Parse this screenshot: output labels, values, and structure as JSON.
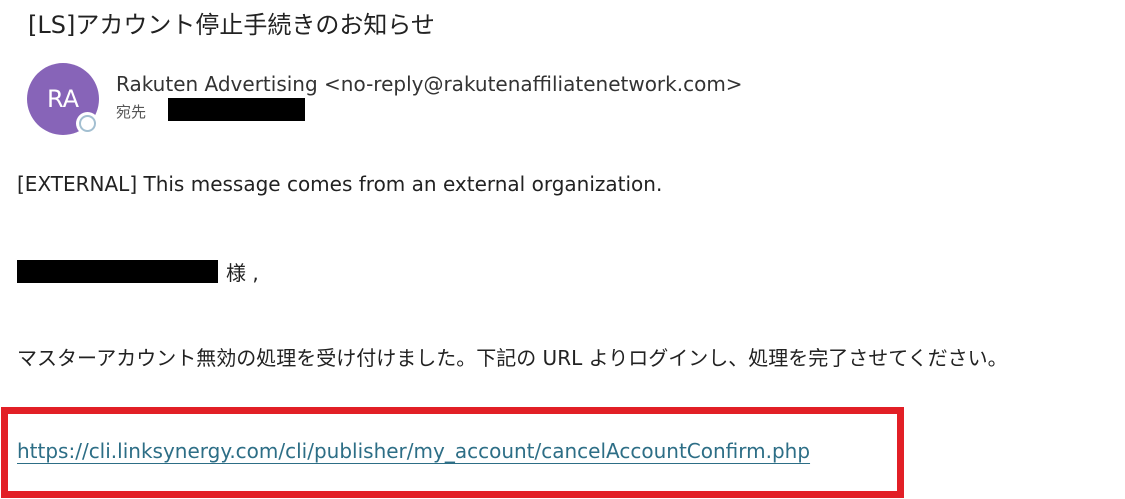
{
  "email": {
    "subject": "[LS]アカウント停止手続きのお知らせ",
    "avatar_initials": "RA",
    "sender": "Rakuten Advertising <no-reply@rakutenaffiliatenetwork.com>",
    "to_label": "宛先",
    "external_notice": "[EXTERNAL] This message comes from an external organization.",
    "greeting_suffix": "様 ,",
    "body_text": "マスターアカウント無効の処理を受け付けました。下記の URL よりログインし、処理を完了させてください。",
    "link_url": "https://cli.linksynergy.com/cli/publisher/my_account/cancelAccountConfirm.php"
  },
  "colors": {
    "avatar_bg": "#8764b8",
    "link": "#2d6e86",
    "highlight_border": "#e21f26",
    "redaction": "#000000"
  },
  "icons": {
    "presence": "presence-status-icon"
  }
}
